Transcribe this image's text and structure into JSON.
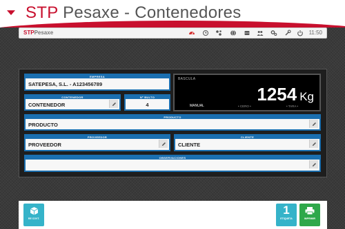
{
  "banner": {
    "brand": "STP",
    "title": "Pesaxe - Contenedores"
  },
  "toolbar": {
    "logo_brand": "STP",
    "logo_text": "Pesaxe",
    "time": "11:50",
    "icons": [
      "scale-icon",
      "history-icon",
      "network-icon",
      "globe-icon",
      "database-icon",
      "users-icon",
      "settings-icon",
      "wrench-icon",
      "power-icon"
    ]
  },
  "form": {
    "empresa": {
      "label": "EMPRESA",
      "value": "SATEPESA, S.L. - A123456789"
    },
    "contenedor": {
      "label": "CONTENEDOR",
      "value": "CONTENEDOR"
    },
    "bulto": {
      "label": "Nº BULTO",
      "value": "4"
    },
    "producto": {
      "label": "PRODUCTO",
      "value": "PRODUCTO"
    },
    "proveedor": {
      "label": "PROVEEDOR",
      "value": "PROVEEDOR"
    },
    "cliente": {
      "label": "CLIENTE",
      "value": "CLIENTE"
    },
    "observaciones": {
      "label": "OBSERVACIONES",
      "value": ""
    }
  },
  "scale": {
    "label": "BASCULA",
    "weight": "1254",
    "unit": "Kg",
    "mode": "MANUAL",
    "zero_label": "• CERO •",
    "tare_label": "• TARA •"
  },
  "footer": {
    "left_label": "RE COVT.",
    "labels_count": "1",
    "labels_label": "ETIQUETA",
    "print_label": "IMPRIMIR"
  },
  "colors": {
    "accent": "#1a6fb0",
    "brand": "#c8102e",
    "teal": "#35b3c9",
    "green": "#2ea84a"
  }
}
